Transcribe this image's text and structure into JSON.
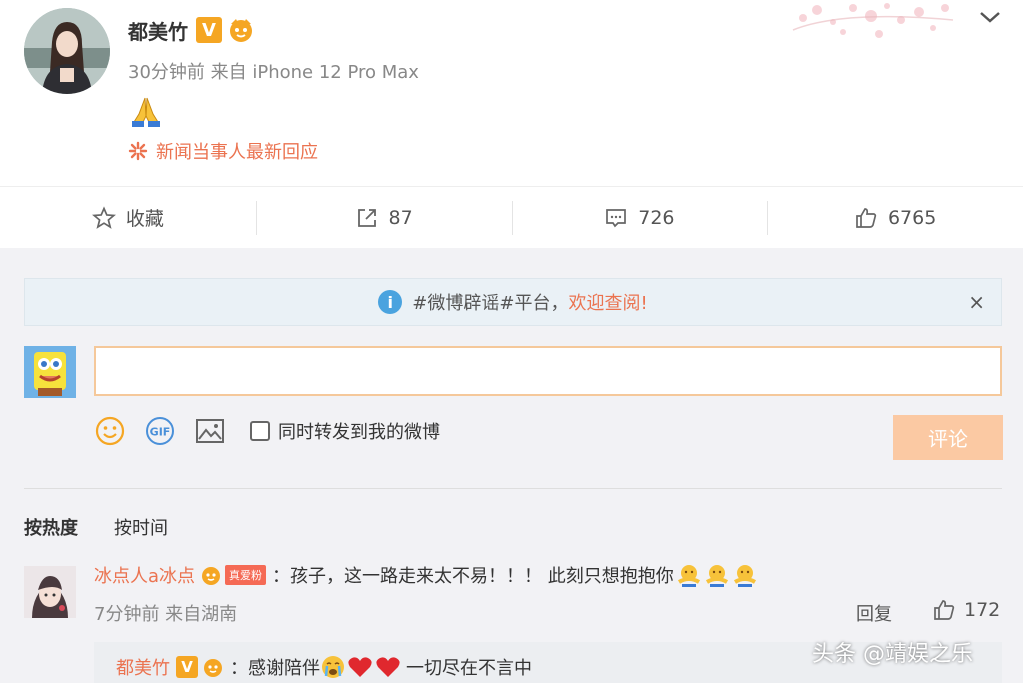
{
  "post": {
    "author": "都美竹",
    "verified_badge": "V",
    "meta": "30分钟前 来自 iPhone 12 Pro Max",
    "content_emoji": "folded-hands",
    "news_link": "新闻当事人最新回应"
  },
  "actions": {
    "favorite": "收藏",
    "repost_count": "87",
    "comment_count": "726",
    "like_count": "6765"
  },
  "notice": {
    "text_a": "#微博辟谣#平台，",
    "text_b": "欢迎查阅!",
    "close": "×"
  },
  "composer": {
    "input_value": "",
    "repost_label": "同时转发到我的微博",
    "submit_label": "评论"
  },
  "sort": {
    "hot": "按热度",
    "time": "按时间"
  },
  "comment": {
    "user": "冰点人a冰点",
    "fan_tag": "真爱粉",
    "text": "：孩子，这一路走来太不易！！！ 此刻只想抱抱你",
    "meta": "7分钟前 来自湖南",
    "reply_label": "回复",
    "like_count": "172"
  },
  "reply": {
    "user": "都美竹",
    "verified_badge": "V",
    "text_a": "：感谢陪伴",
    "text_b": "一切尽在不言中"
  },
  "watermark": "头条 @靖娱之乐",
  "colors": {
    "accent": "#eb7350",
    "submit_bg": "#fbc9a3",
    "verified": "#f5a623",
    "notice_bg": "#eaf1f6",
    "page_bg": "#f2f2f5"
  }
}
